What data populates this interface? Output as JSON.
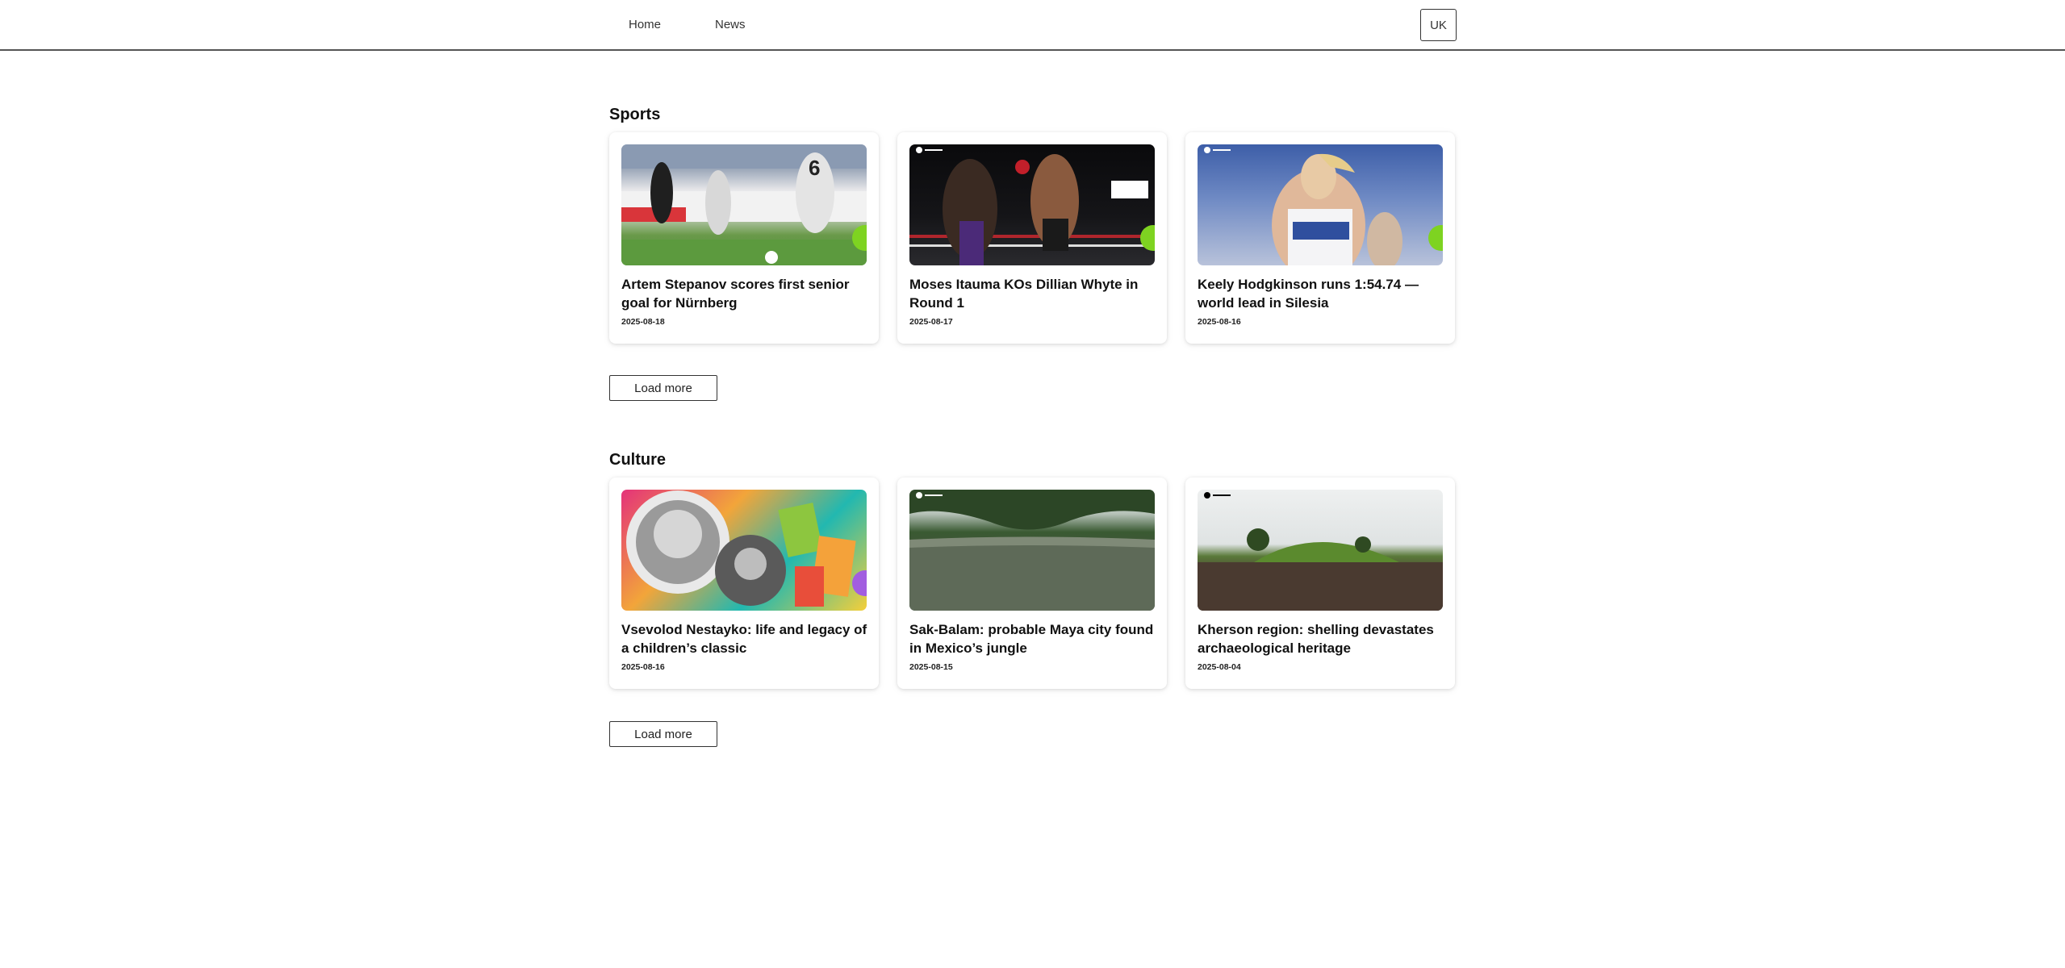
{
  "nav": {
    "home": "Home",
    "news": "News",
    "lang": "UK"
  },
  "sections": [
    {
      "title": "Sports",
      "load_more": "Load more",
      "cards": [
        {
          "title": "Artem Stepanov scores first senior goal for Nürnberg",
          "date": "2025-08-18",
          "accent": "#7ed321"
        },
        {
          "title": "Moses Itauma KOs Dillian Whyte in Round 1",
          "date": "2025-08-17",
          "accent": "#7ed321"
        },
        {
          "title": "Keely Hodgkinson runs 1:54.74 — world lead in Silesia",
          "date": "2025-08-16",
          "accent": "#7ed321"
        }
      ]
    },
    {
      "title": "Culture",
      "load_more": "Load more",
      "cards": [
        {
          "title": "Vsevolod Nestayko: life and legacy of a children’s classic",
          "date": "2025-08-16",
          "accent": "#a25ee0"
        },
        {
          "title": "Sak-Balam: probable Maya city found in Mexico’s jungle",
          "date": "2025-08-15",
          "accent": ""
        },
        {
          "title": "Kherson region: shelling devastates archaeological heritage",
          "date": "2025-08-04",
          "accent": ""
        }
      ]
    }
  ]
}
